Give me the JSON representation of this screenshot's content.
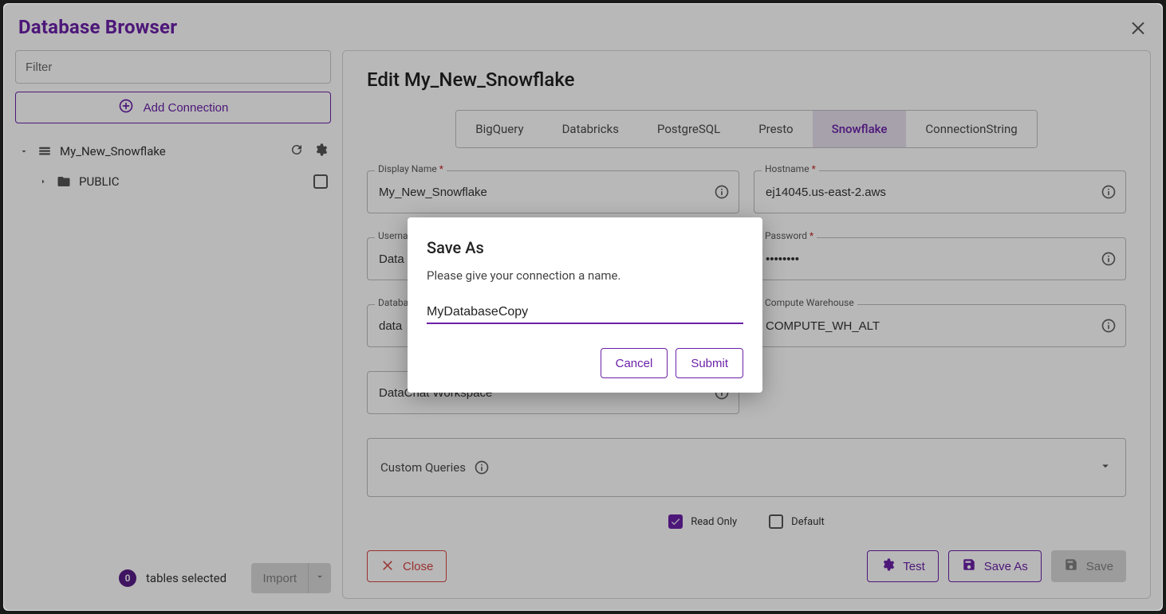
{
  "app": {
    "title": "Database Browser"
  },
  "sidebar": {
    "filter_placeholder": "Filter",
    "add_connection_label": "Add Connection",
    "tree": {
      "connection": {
        "name": "My_New_Snowflake"
      },
      "schema": {
        "name": "PUBLIC"
      }
    },
    "footer": {
      "count": "0",
      "label": "tables selected",
      "import_label": "Import"
    }
  },
  "main": {
    "title": "Edit My_New_Snowflake",
    "tabs": [
      "BigQuery",
      "Databricks",
      "PostgreSQL",
      "Presto",
      "Snowflake",
      "ConnectionString"
    ],
    "active_tab": "Snowflake",
    "fields": {
      "display_name": {
        "label": "Display Name",
        "value": "My_New_Snowflake",
        "required": true
      },
      "hostname": {
        "label": "Hostname",
        "value": "ej14045.us-east-2.aws",
        "required": true
      },
      "username": {
        "label": "Username",
        "value": "Data",
        "required": true
      },
      "password": {
        "label": "Password",
        "value": "••••••••",
        "required": true
      },
      "database": {
        "label": "Database",
        "value": "data",
        "required": true
      },
      "warehouse": {
        "label": "Compute Warehouse",
        "value": "COMPUTE_WH_ALT",
        "required": false
      },
      "workspace": {
        "label": "",
        "value": "DataChat Workspace",
        "required": false
      }
    },
    "custom_queries_label": "Custom Queries",
    "read_only": {
      "label": "Read Only",
      "checked": true
    },
    "default": {
      "label": "Default",
      "checked": false
    },
    "buttons": {
      "close": "Close",
      "test": "Test",
      "save_as": "Save As",
      "save": "Save"
    }
  },
  "modal": {
    "title": "Save As",
    "prompt": "Please give your connection a name.",
    "value": "MyDatabaseCopy",
    "cancel": "Cancel",
    "submit": "Submit"
  }
}
